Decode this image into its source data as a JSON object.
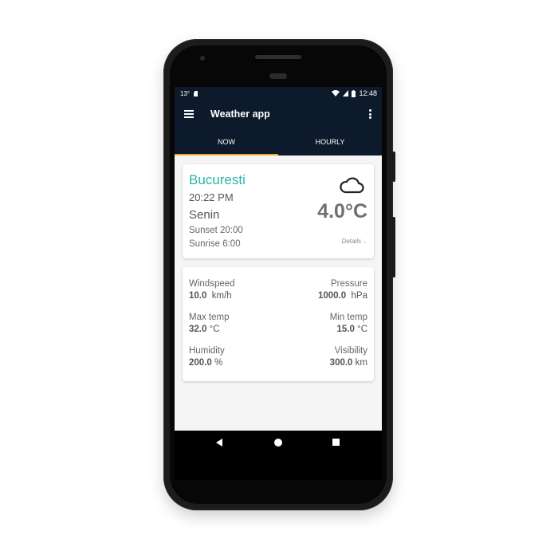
{
  "status_bar": {
    "temp_indicator": "13°",
    "time": "12:48"
  },
  "app_bar": {
    "title": "Weather app"
  },
  "tabs": [
    {
      "label": "NOW",
      "selected": true
    },
    {
      "label": "HOURLY",
      "selected": false
    }
  ],
  "accent_colors": {
    "app_bar": "#0c1a2b",
    "tab_indicator": "#f5a623",
    "city": "#2bb5a6"
  },
  "current": {
    "city": "Bucuresti",
    "time": "20:22 PM",
    "condition": "Senin",
    "sunset_label": "Sunset",
    "sunset_time": "20:00",
    "sunrise_label": "Sunrise",
    "sunrise_time": "6:00",
    "temperature": "4.0°C",
    "details_label": "Details",
    "weather_icon": "cloud-icon"
  },
  "details": {
    "windspeed": {
      "label": "Windspeed",
      "value": "10.0",
      "unit": "km/h"
    },
    "pressure": {
      "label": "Pressure",
      "value": "1000.0",
      "unit": "hPa"
    },
    "max_temp": {
      "label": "Max temp",
      "value": "32.0",
      "unit": "°C"
    },
    "min_temp": {
      "label": "Min temp",
      "value": "15.0",
      "unit": "°C"
    },
    "humidity": {
      "label": "Humidity",
      "value": "200.0",
      "unit": "%"
    },
    "visibility": {
      "label": "Visibility",
      "value": "300.0",
      "unit": "km"
    }
  }
}
